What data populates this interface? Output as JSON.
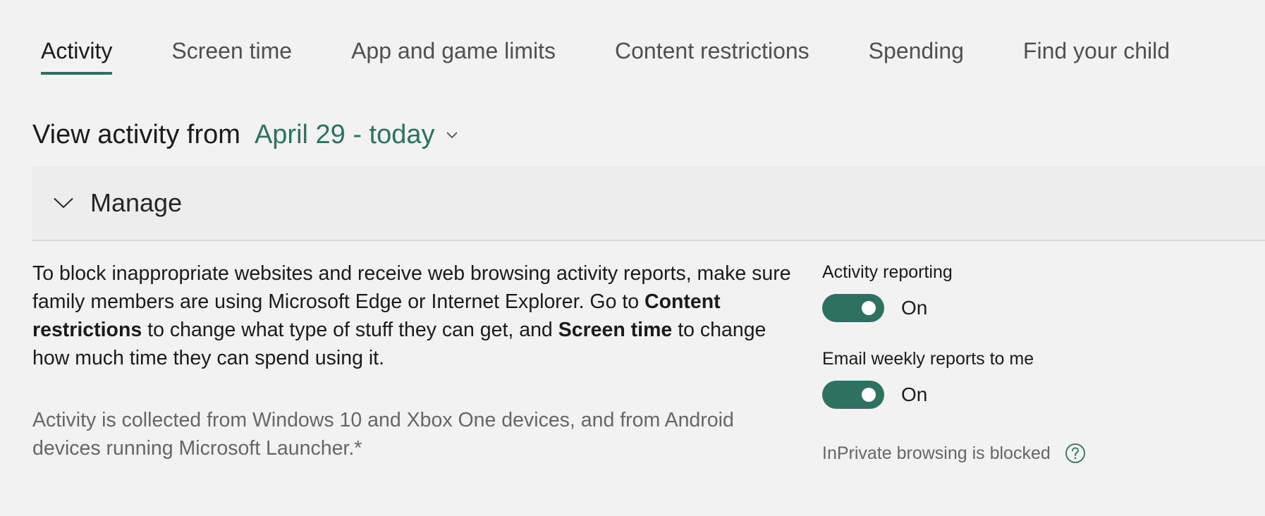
{
  "tabs": [
    {
      "label": "Activity",
      "active": true
    },
    {
      "label": "Screen time",
      "active": false
    },
    {
      "label": "App and game limits",
      "active": false
    },
    {
      "label": "Content restrictions",
      "active": false
    },
    {
      "label": "Spending",
      "active": false
    },
    {
      "label": "Find your child",
      "active": false
    }
  ],
  "view": {
    "label": "View activity from",
    "range": "April 29 - today",
    "dropdown_icon": "chevron-down-icon"
  },
  "manage": {
    "title": "Manage",
    "icon": "chevron-down-icon"
  },
  "description": {
    "part1": "To block inappropriate websites and receive web browsing activity reports, make sure family members are using Microsoft Edge or Internet Explorer. Go to ",
    "bold1": "Content restrictions",
    "part2": " to change what type of stuff they can get, and ",
    "bold2": "Screen time",
    "part3": " to change how much time they can spend using it."
  },
  "note": "Activity is collected from Windows 10 and Xbox One devices, and from Android devices running Microsoft Launcher.*",
  "settings": {
    "activity_reporting": {
      "label": "Activity reporting",
      "state": "On",
      "enabled": true
    },
    "email_reports": {
      "label": "Email weekly reports to me",
      "state": "On",
      "enabled": true
    },
    "inprivate": {
      "text": "InPrivate browsing is blocked",
      "icon": "help-circle-icon"
    }
  },
  "colors": {
    "accent": "#2e7160",
    "background": "#f2f2f2",
    "manage_bg": "#ededed",
    "muted_text": "#666666"
  }
}
